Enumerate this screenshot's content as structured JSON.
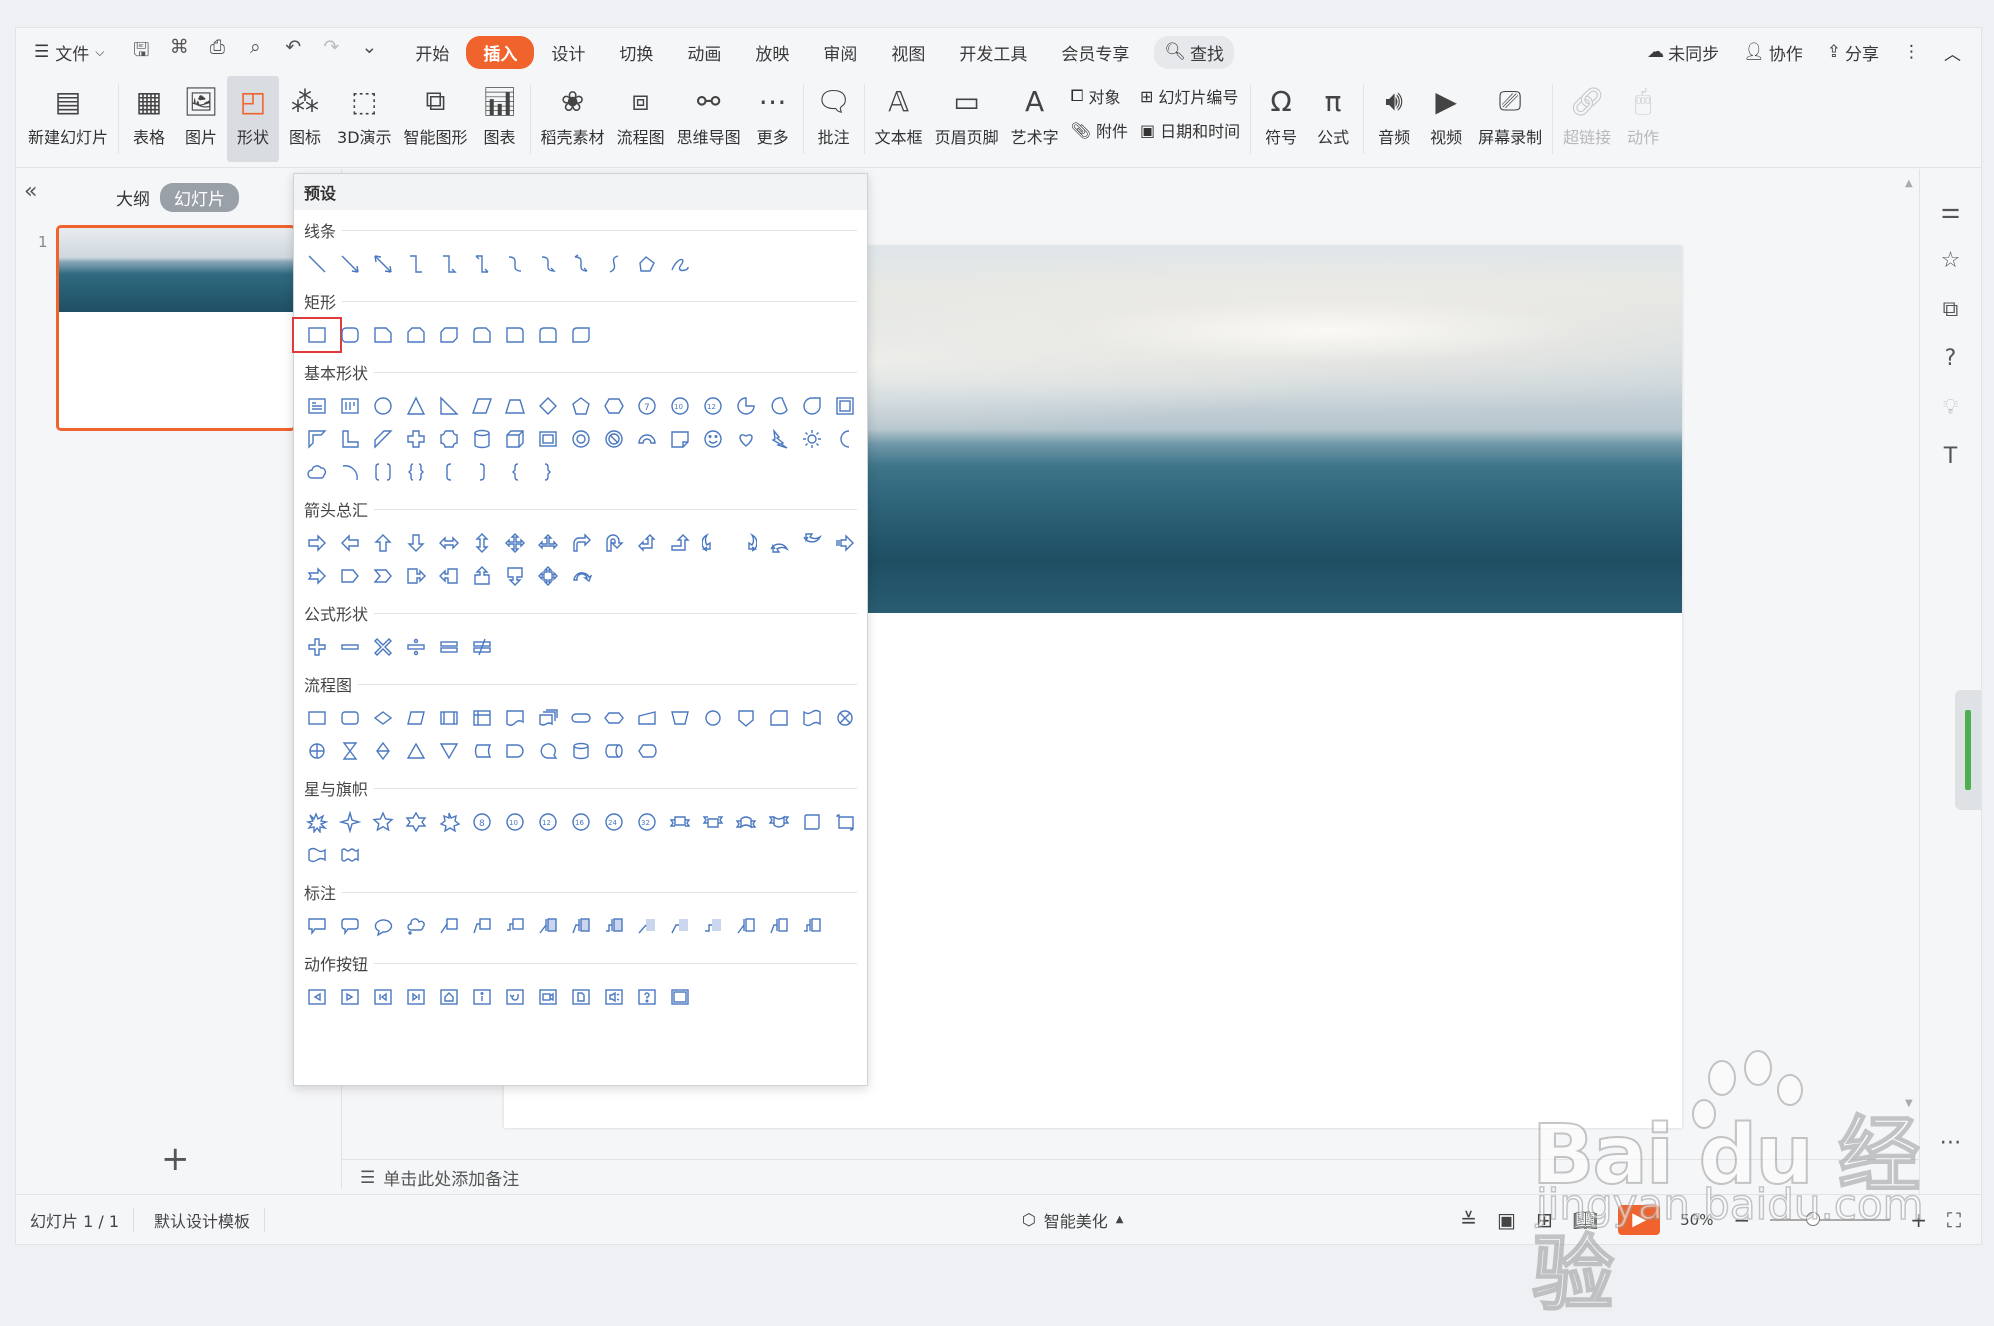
{
  "menubar": {
    "file_label": "文件",
    "tabs": [
      "开始",
      "插入",
      "设计",
      "切换",
      "动画",
      "放映",
      "审阅",
      "视图",
      "开发工具",
      "会员专享"
    ],
    "active_tab": "插入",
    "search_label": "查找",
    "right": {
      "sync": "未同步",
      "collab": "协作",
      "share": "分享"
    }
  },
  "ribbon": {
    "new_slide": "新建幻灯片",
    "table": "表格",
    "picture": "图片",
    "shape": "形状",
    "icon": "图标",
    "demo3d": "3D演示",
    "smartart": "智能图形",
    "chart": "图表",
    "docer": "稻壳素材",
    "flowchart": "流程图",
    "mindmap": "思维导图",
    "more": "更多",
    "comment": "批注",
    "textbox": "文本框",
    "header_footer": "页眉页脚",
    "wordart": "艺术字",
    "object": "对象",
    "attachment": "附件",
    "slide_number": "幻灯片编号",
    "datetime": "日期和时间",
    "symbol": "符号",
    "formula": "公式",
    "audio": "音频",
    "video": "视频",
    "screen_record": "屏幕录制",
    "hyperlink": "超链接",
    "action": "动作"
  },
  "leftpanel": {
    "outline_tab": "大纲",
    "slides_tab": "幻灯片",
    "slide_number": "1"
  },
  "shapes_menu": {
    "header": "预设",
    "sections": {
      "lines": "线条",
      "rect": "矩形",
      "basic": "基本形状",
      "arrows": "箭头总汇",
      "equation": "公式形状",
      "flow": "流程图",
      "stars": "星与旗帜",
      "callouts": "标注",
      "actions": "动作按钮"
    }
  },
  "notes": {
    "placeholder": "单击此处添加备注"
  },
  "status": {
    "slide_info": "幻灯片 1 / 1",
    "template": "默认设计模板",
    "beautify": "智能美化",
    "zoom": "50%"
  },
  "watermark": {
    "brand": "Bai du 经验",
    "url": "jingyan.baidu.com"
  },
  "colors": {
    "accent": "#f0632c",
    "shape_stroke": "#4a78c0",
    "highlight": "#e03a3a"
  }
}
